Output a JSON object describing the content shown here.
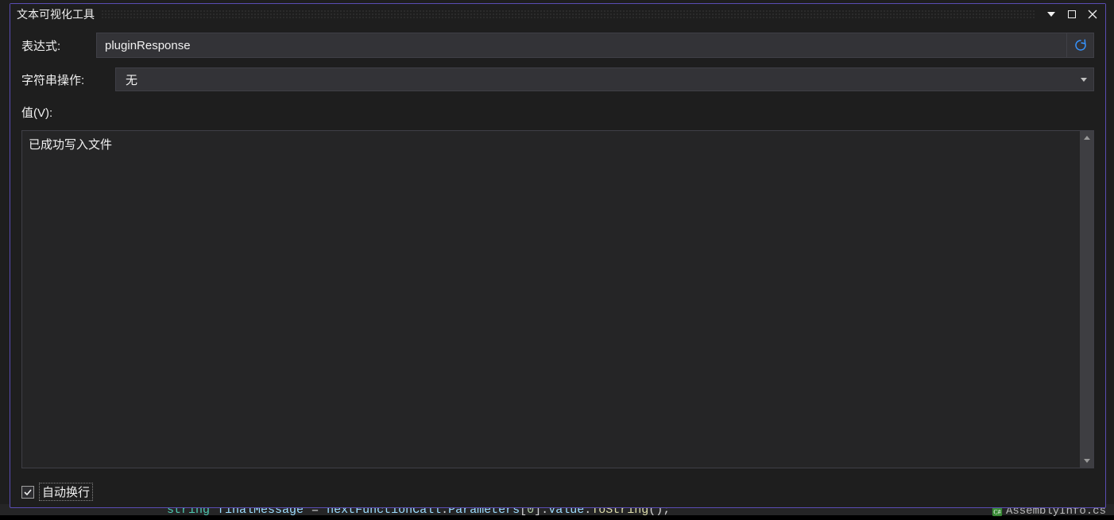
{
  "titlebar": {
    "title": "文本可视化工具"
  },
  "expression": {
    "label": "表达式:",
    "value": "pluginResponse"
  },
  "stringOp": {
    "label": "字符串操作:",
    "selected": "无"
  },
  "valueSection": {
    "label": "值(V):",
    "content": "已成功写入文件"
  },
  "wrap": {
    "label": "自动换行",
    "checked": true
  },
  "codeStrip": {
    "type": "string",
    "varName": "finalMessage",
    "eq": "=",
    "expr1": "nextFunctionCall",
    "dot1": ".",
    "expr2": "Parameters",
    "brO": "[",
    "idx": "0",
    "brC": "]",
    "dot2": ".",
    "expr3": "Value",
    "dot3": ".",
    "method": "ToString",
    "parO": "(",
    "parC": ")",
    "semi": ";",
    "rightFile": "AssemblyInfo.cs"
  }
}
